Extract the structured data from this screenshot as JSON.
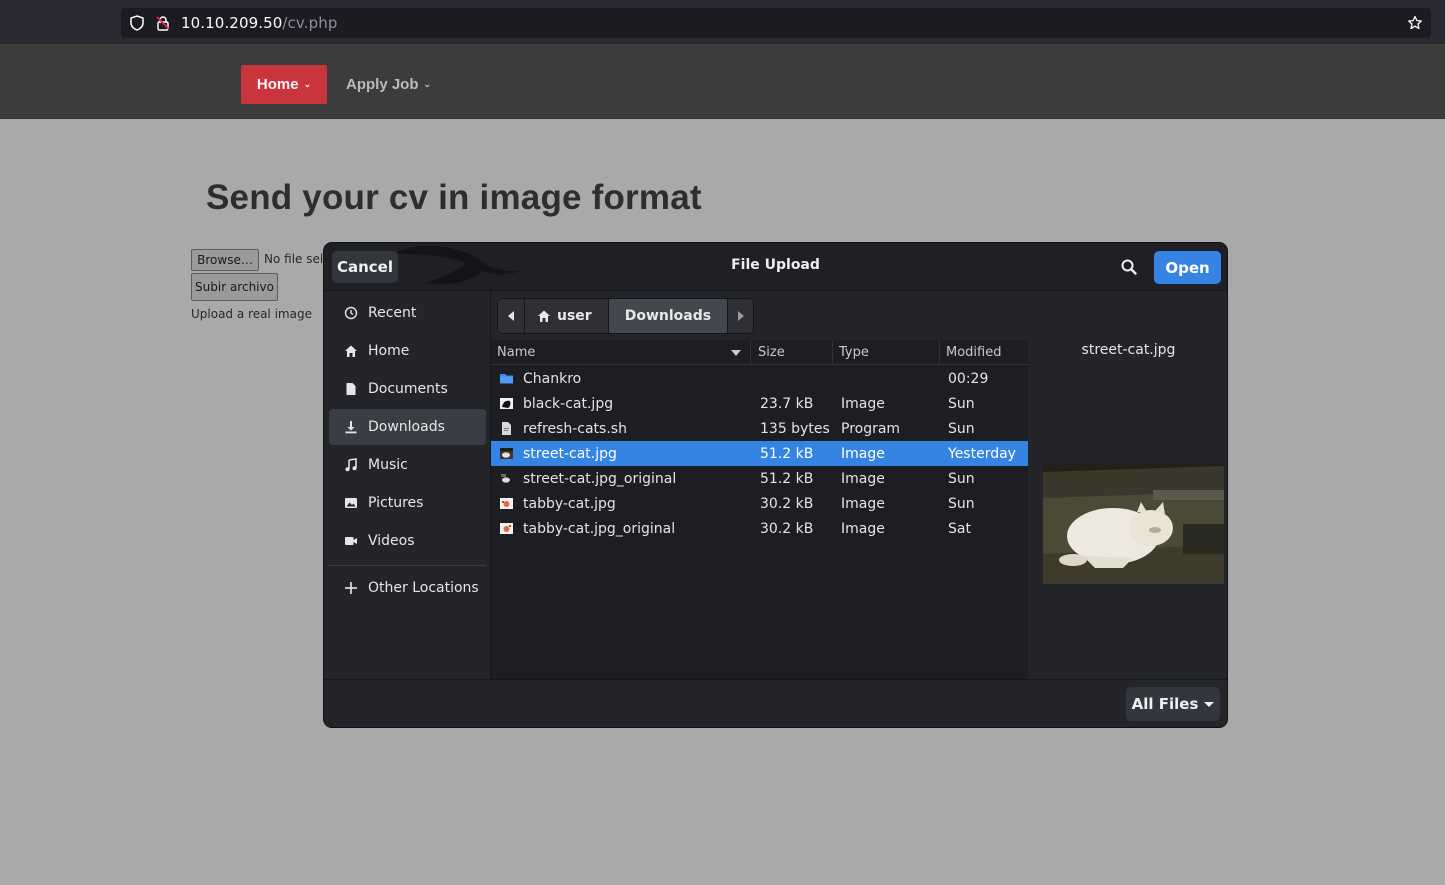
{
  "browser": {
    "url_host": "10.10.209.50",
    "url_path": "/cv.php"
  },
  "nav": {
    "home_label": "Home",
    "apply_label": "Apply Job"
  },
  "page": {
    "heading": "Send your cv in image format",
    "browse_label": "Browse…",
    "no_file_label": "No file selected.",
    "submit_label": "Subir archivo",
    "hint": "Upload a real image"
  },
  "dialog": {
    "title": "File Upload",
    "cancel_label": "Cancel",
    "open_label": "Open",
    "filter_label": "All Files",
    "sidebar": [
      {
        "label": "Recent",
        "icon": "clock-icon"
      },
      {
        "label": "Home",
        "icon": "home-icon"
      },
      {
        "label": "Documents",
        "icon": "document-icon"
      },
      {
        "label": "Downloads",
        "icon": "download-icon",
        "active": true
      },
      {
        "label": "Music",
        "icon": "music-icon"
      },
      {
        "label": "Pictures",
        "icon": "picture-icon"
      },
      {
        "label": "Videos",
        "icon": "video-icon"
      },
      {
        "label": "Other Locations",
        "icon": "plus-icon"
      }
    ],
    "path": {
      "segments": [
        "user",
        "Downloads"
      ]
    },
    "columns": {
      "name": "Name",
      "size": "Size",
      "type": "Type",
      "modified": "Modified"
    },
    "files": [
      {
        "name": "Chankro",
        "size": "",
        "type": "",
        "modified": "00:29",
        "icon": "folder-icon"
      },
      {
        "name": "black-cat.jpg",
        "size": "23.7 kB",
        "type": "Image",
        "modified": "Sun",
        "icon": "image-thumb-icon"
      },
      {
        "name": "refresh-cats.sh",
        "size": "135 bytes",
        "type": "Program",
        "modified": "Sun",
        "icon": "script-file-icon"
      },
      {
        "name": "street-cat.jpg",
        "size": "51.2 kB",
        "type": "Image",
        "modified": "Yesterday",
        "icon": "image-thumb-icon",
        "selected": true
      },
      {
        "name": "street-cat.jpg_original",
        "size": "51.2 kB",
        "type": "Image",
        "modified": "Sun",
        "icon": "image-thumb-icon"
      },
      {
        "name": "tabby-cat.jpg",
        "size": "30.2 kB",
        "type": "Image",
        "modified": "Sun",
        "icon": "image-thumb-icon"
      },
      {
        "name": "tabby-cat.jpg_original",
        "size": "30.2 kB",
        "type": "Image",
        "modified": "Sat",
        "icon": "image-thumb-icon"
      }
    ],
    "preview_name": "street-cat.jpg"
  },
  "colors": {
    "accent": "#3584e4",
    "nav_home_bg": "#c9353d"
  }
}
